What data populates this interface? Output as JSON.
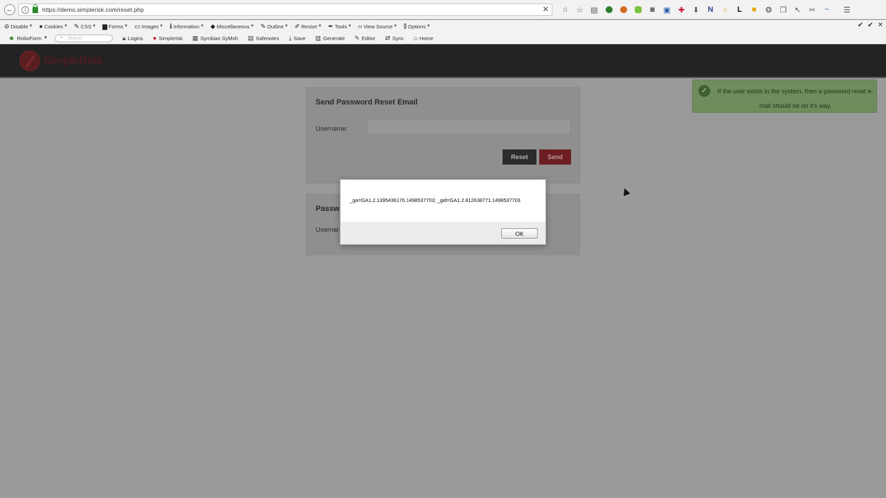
{
  "browser": {
    "url": "https://demo.simplerisk.com/reset.php",
    "clear_glyph": "✕",
    "back_glyph": "←",
    "toolbar_icons": [
      "home-icon",
      "bookmark-star-icon",
      "reading-list-icon",
      "extension-green-icon",
      "extension-orange-icon",
      "extension-lime-icon",
      "pocket-icon",
      "save-disk-icon",
      "extension-red-cross-icon",
      "download-icon",
      "onenote-icon",
      "sun-icon",
      "lastpass-icon",
      "folder-icon",
      "wolfram-icon",
      "page-icon",
      "cursor-tool-icon",
      "scissors-icon",
      "sync-wave-icon",
      "hamburger-menu-icon"
    ]
  },
  "devbar": {
    "items": [
      "Disable",
      "Cookies",
      "CSS",
      "Forms",
      "Images",
      "Information",
      "Miscellaneous",
      "Outline",
      "Resize",
      "Tools",
      "View Source",
      "Options"
    ]
  },
  "bookmarks": {
    "roboform_label": "RoboForm",
    "search_placeholder": "Search",
    "items": [
      "Logins",
      "Simplerisk",
      "Symbian SyMoh",
      "Safenotes",
      "Save",
      "Generate",
      "Editor",
      "Sync",
      "Home"
    ]
  },
  "header": {
    "logo_text": "SimpleRisk"
  },
  "reset_card": {
    "title": "Send Password Reset Email",
    "username_label": "Username:",
    "reset_label": "Reset",
    "send_label": "Send"
  },
  "second_card": {
    "title": "Passw",
    "username_label": "Usernar"
  },
  "toast": {
    "message": "If the user exists in the system, then a password reset e-mail should be on it's way."
  },
  "modal": {
    "message": "_ga=GA1.2.1395436176.1498537703; _gid=GA1.2.812638771.1498537703",
    "ok_label": "OK"
  },
  "colors": {
    "header_bg": "#232323",
    "send_red": "#6d1e22",
    "toast_green": "#6f8d5c"
  }
}
